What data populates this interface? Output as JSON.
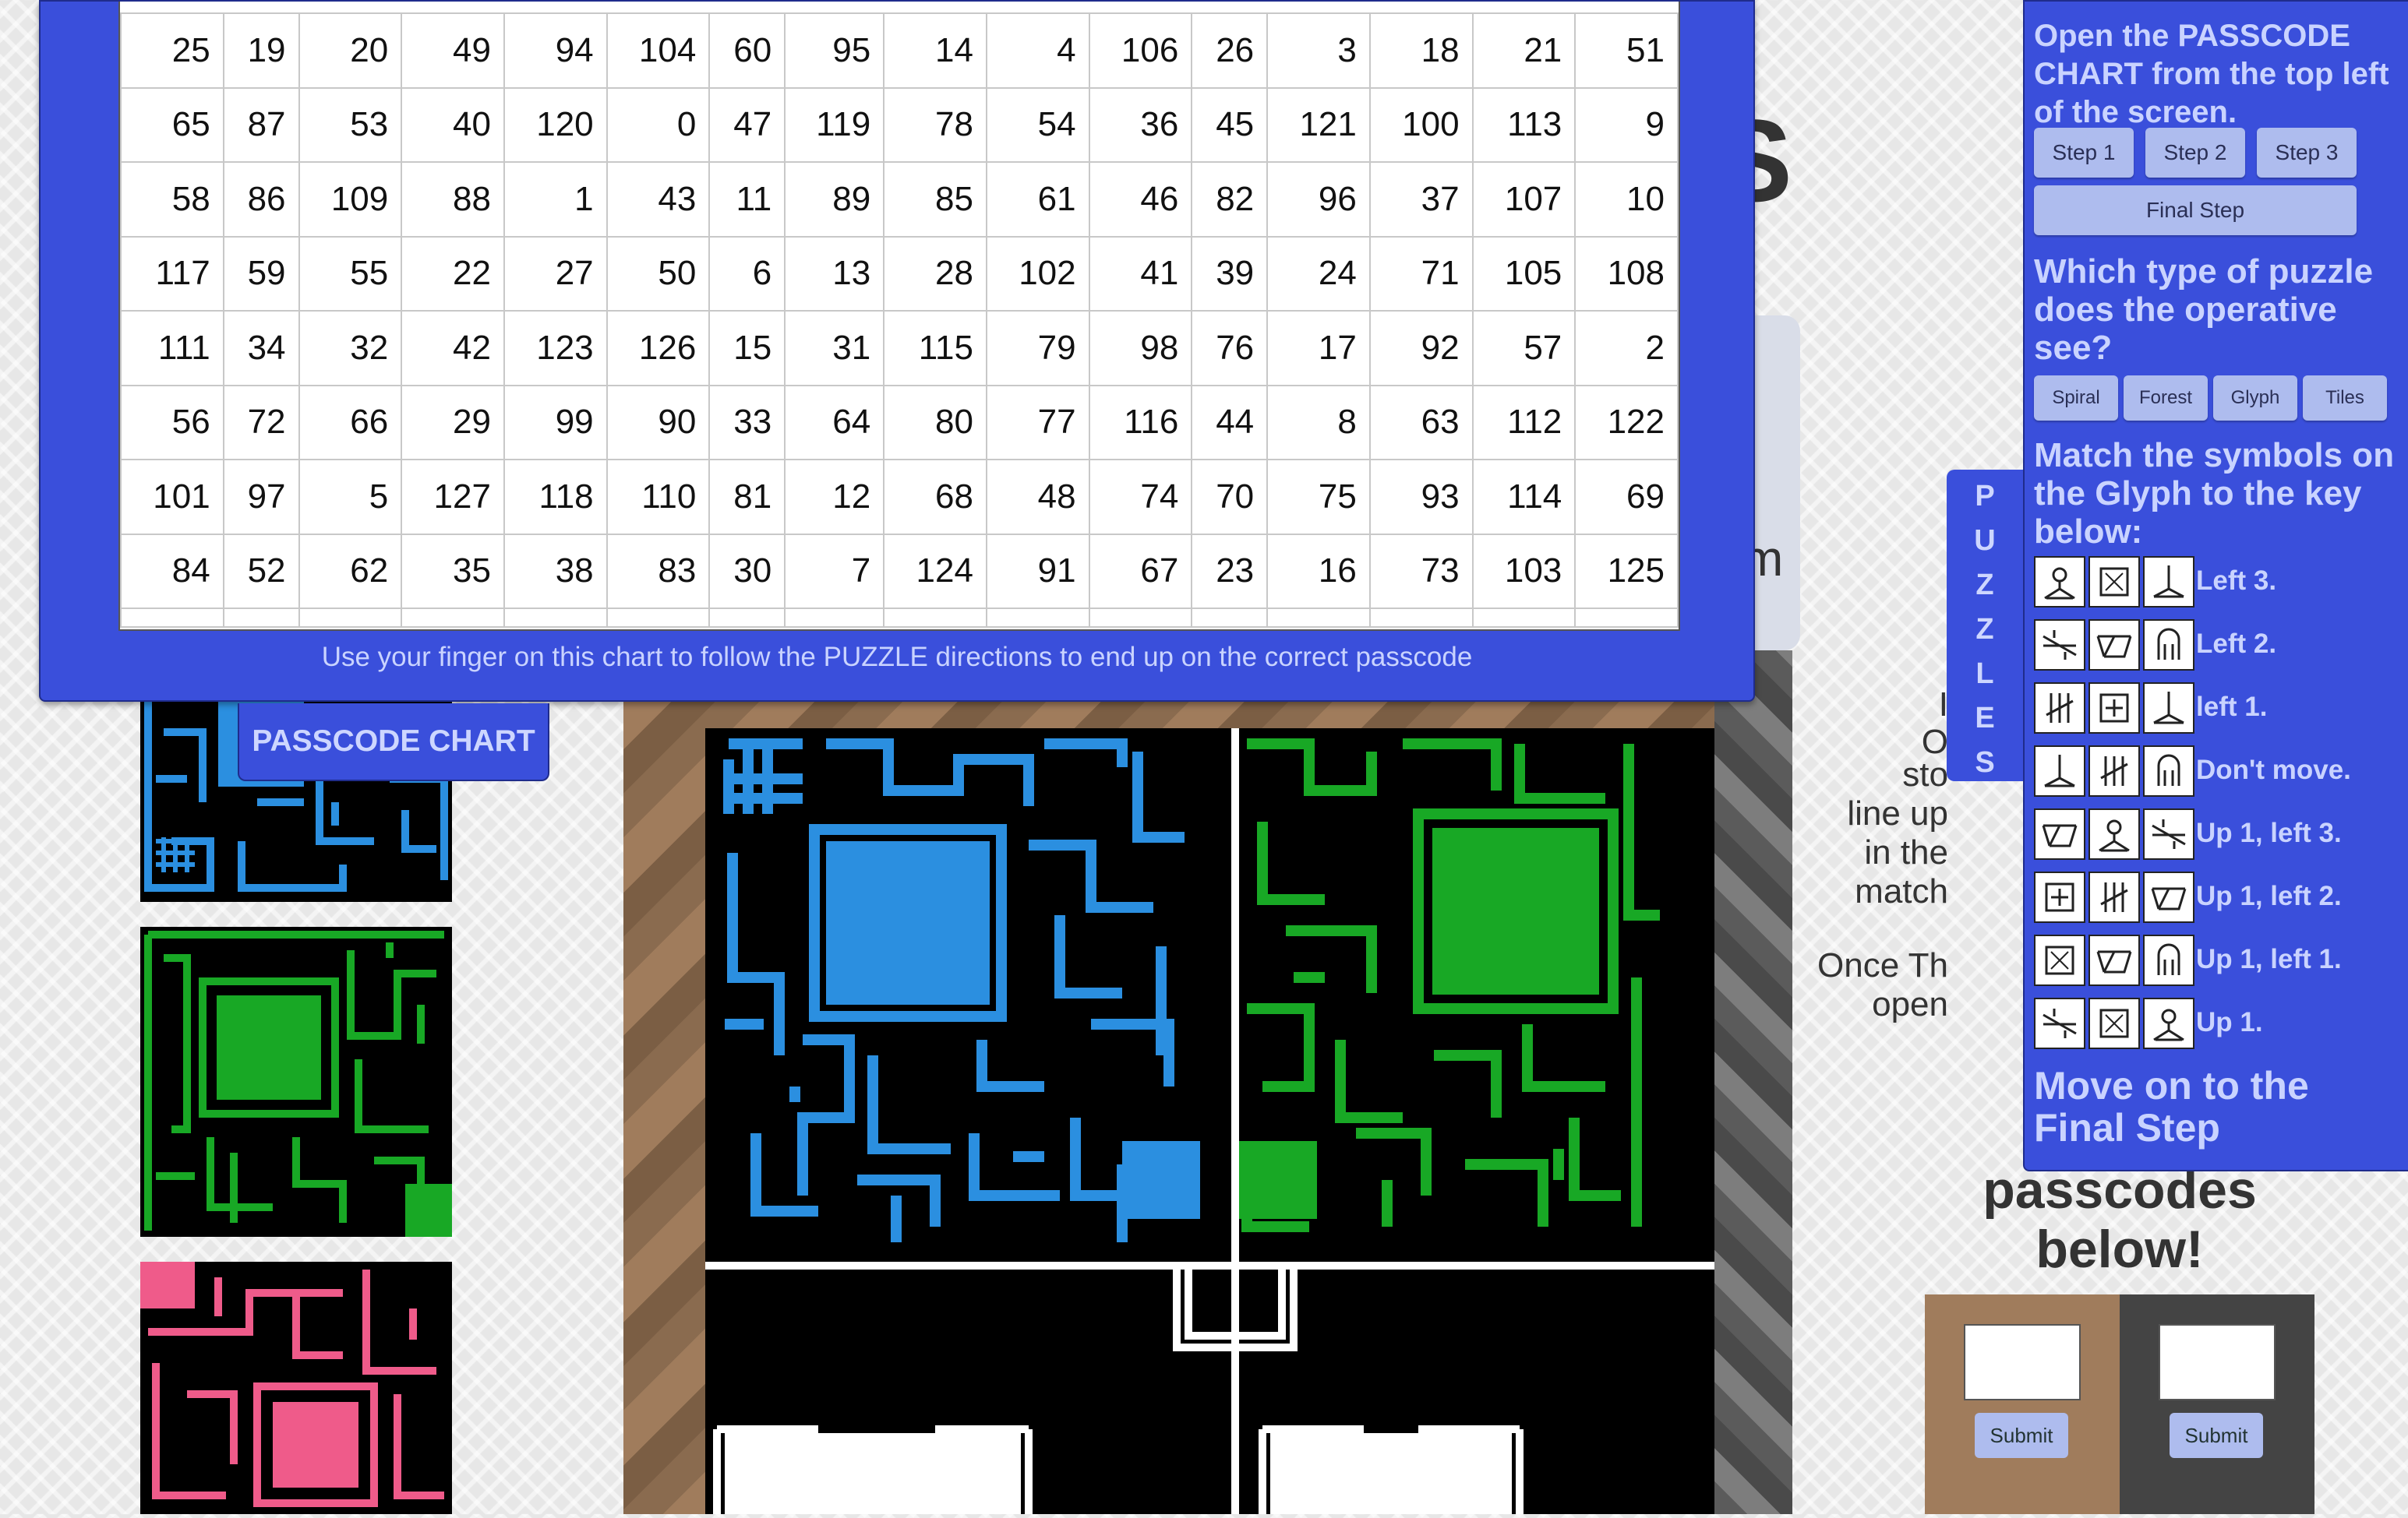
{
  "background": {
    "title_fragment": "S",
    "side_fragment_m": "m",
    "instructions_fragments": [
      "I",
      "O",
      "sto",
      "line up",
      "in the",
      "match",
      "Once Th",
      "open"
    ],
    "passcodes_heading": [
      "passcodes",
      "below!"
    ]
  },
  "passcode_chart": {
    "tab_label": "PASSCODE CHART",
    "instructions": "Use your finger on this chart to follow the PUZZLE directions to end up on the correct passcode",
    "rows": [
      [
        "25",
        "19",
        "20",
        "49",
        "94",
        "104",
        "60",
        "95",
        "14",
        "4",
        "106",
        "26",
        "3",
        "18",
        "21",
        "51"
      ],
      [
        "65",
        "87",
        "53",
        "40",
        "120",
        "0",
        "47",
        "119",
        "78",
        "54",
        "36",
        "45",
        "121",
        "100",
        "113",
        "9"
      ],
      [
        "58",
        "86",
        "109",
        "88",
        "1",
        "43",
        "11",
        "89",
        "85",
        "61",
        "46",
        "82",
        "96",
        "37",
        "107",
        "10"
      ],
      [
        "117",
        "59",
        "55",
        "22",
        "27",
        "50",
        "6",
        "13",
        "28",
        "102",
        "41",
        "39",
        "24",
        "71",
        "105",
        "108"
      ],
      [
        "111",
        "34",
        "32",
        "42",
        "123",
        "126",
        "15",
        "31",
        "115",
        "79",
        "98",
        "76",
        "17",
        "92",
        "57",
        "2"
      ],
      [
        "56",
        "72",
        "66",
        "29",
        "99",
        "90",
        "33",
        "64",
        "80",
        "77",
        "116",
        "44",
        "8",
        "63",
        "112",
        "122"
      ],
      [
        "101",
        "97",
        "5",
        "127",
        "118",
        "110",
        "81",
        "12",
        "68",
        "48",
        "74",
        "70",
        "75",
        "93",
        "114",
        "69"
      ],
      [
        "84",
        "52",
        "62",
        "35",
        "38",
        "83",
        "30",
        "7",
        "124",
        "91",
        "67",
        "23",
        "16",
        "73",
        "103",
        "125"
      ]
    ]
  },
  "puzzles_tab": {
    "letters": [
      "P",
      "U",
      "Z",
      "Z",
      "L",
      "E",
      "S"
    ]
  },
  "guide": {
    "intro": "Open the PASSCODE CHART from the top left of the screen.",
    "steps": [
      "Step 1",
      "Step 2",
      "Step 3"
    ],
    "final_step": "Final Step",
    "question": "Which type of puzzle does the operative see?",
    "puzzle_types": [
      "Spiral",
      "Forest",
      "Glyph",
      "Tiles"
    ],
    "match_instructions": "Match the symbols on the Glyph to the key below:",
    "key": [
      {
        "symbols": [
          "figure-glyph",
          "box-glyph",
          "tripod-glyph"
        ],
        "direction": "Left 3."
      },
      {
        "symbols": [
          "slash-glyph",
          "trapezoid-glyph",
          "arch-glyph"
        ],
        "direction": "Left 2."
      },
      {
        "symbols": [
          "bars-glyph",
          "crossbox-glyph",
          "tripod-glyph"
        ],
        "direction": "left 1."
      },
      {
        "symbols": [
          "tripod-glyph",
          "bars-glyph",
          "arch-glyph"
        ],
        "direction": "Don't move."
      },
      {
        "symbols": [
          "trapezoid-glyph",
          "figure-glyph",
          "slash-glyph"
        ],
        "direction": "Up 1, left 3."
      },
      {
        "symbols": [
          "crossbox-glyph",
          "bars-glyph",
          "trapezoid-glyph"
        ],
        "direction": "Up 1, left 2."
      },
      {
        "symbols": [
          "box-glyph",
          "trapezoid-glyph",
          "arch-glyph"
        ],
        "direction": "Up 1, left 1."
      },
      {
        "symbols": [
          "slash-glyph",
          "box-glyph",
          "figure-glyph"
        ],
        "direction": "Up 1."
      }
    ],
    "move_on": "Move on to the Final Step"
  },
  "passcode_entry": {
    "submit_label": "Submit"
  },
  "colors": {
    "panel": "#3a4fdb",
    "maze_blue": "#2b8fe0",
    "maze_green": "#18a825",
    "maze_pink": "#ef5b8a"
  }
}
